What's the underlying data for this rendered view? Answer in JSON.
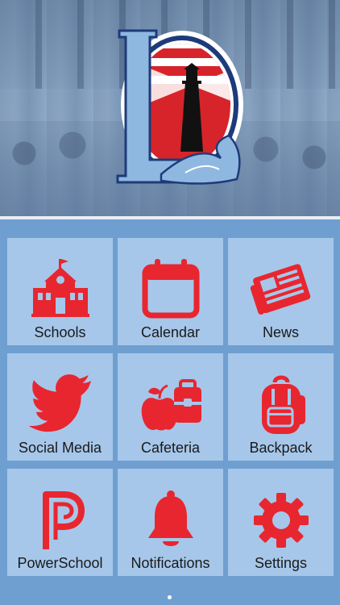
{
  "colors": {
    "accent": "#e8262f",
    "tile": "#a6c7ea",
    "grid_bg": "#6f9fd0"
  },
  "logo": {
    "letter": "L",
    "icon": "lighthouse-logo"
  },
  "tiles": [
    {
      "label": "Schools",
      "icon": "school-icon"
    },
    {
      "label": "Calendar",
      "icon": "calendar-icon"
    },
    {
      "label": "News",
      "icon": "newspaper-icon"
    },
    {
      "label": "Social Media",
      "icon": "twitter-icon"
    },
    {
      "label": "Cafeteria",
      "icon": "apple-lunchbox-icon"
    },
    {
      "label": "Backpack",
      "icon": "backpack-icon"
    },
    {
      "label": "PowerSchool",
      "icon": "powerschool-icon"
    },
    {
      "label": "Notifications",
      "icon": "bell-icon"
    },
    {
      "label": "Settings",
      "icon": "gear-icon"
    }
  ],
  "pager": {
    "current_page": 1,
    "total_pages": 1
  }
}
